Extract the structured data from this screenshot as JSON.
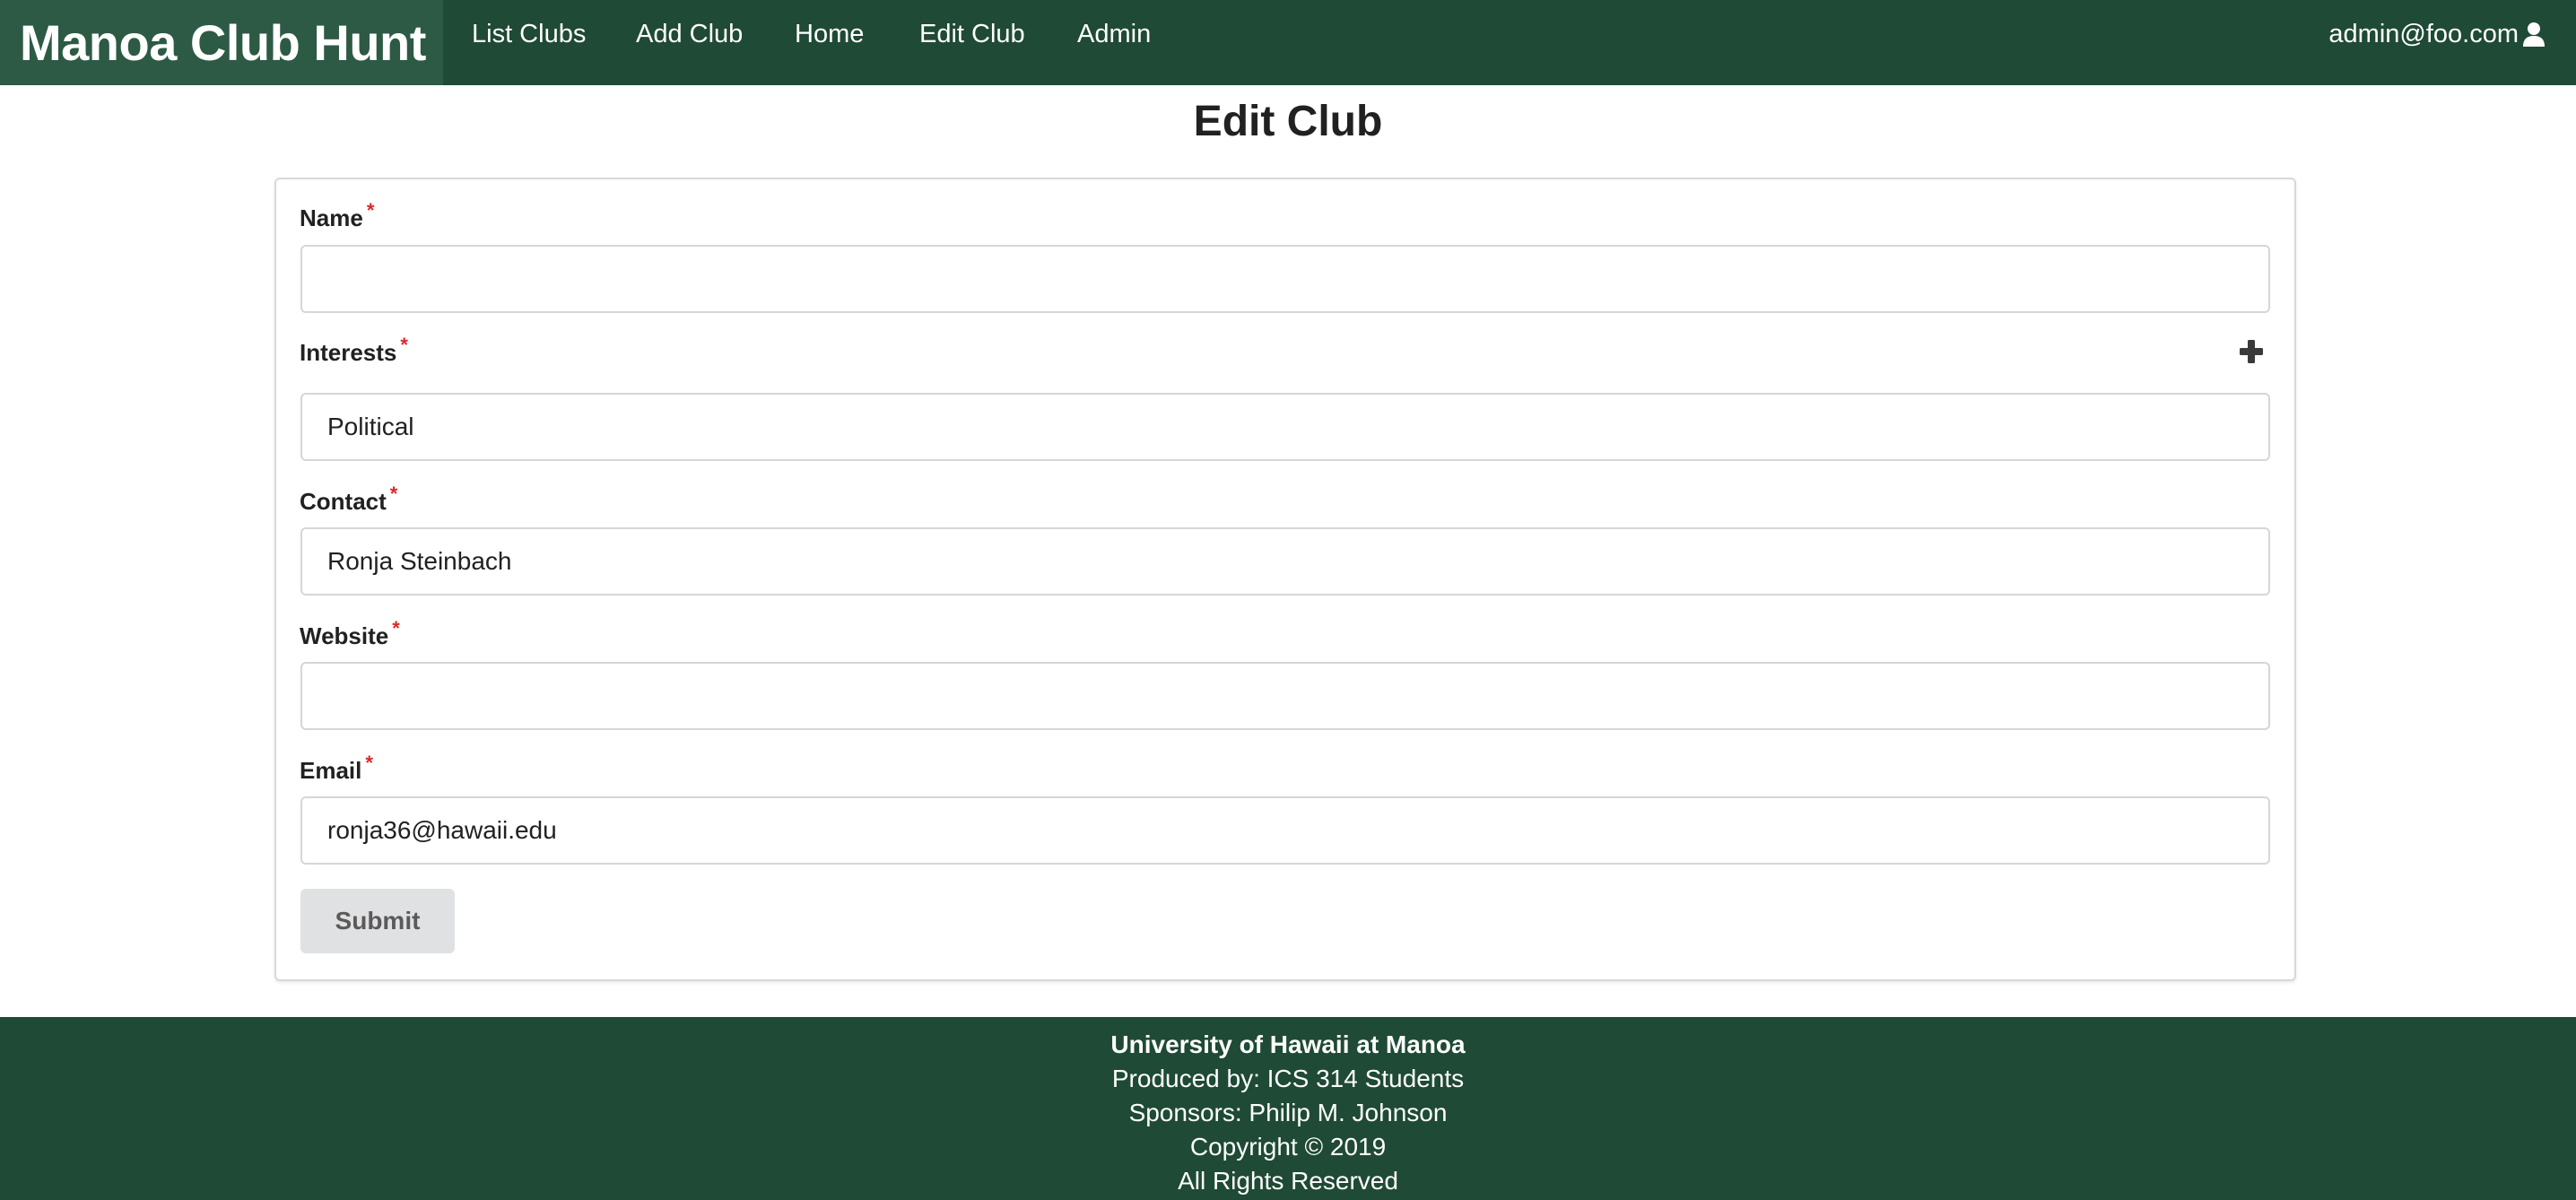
{
  "navbar": {
    "brand": "Manoa Club Hunt",
    "items": [
      "List Clubs",
      "Add Club",
      "Home",
      "Edit Club",
      "Admin"
    ],
    "user": "admin@foo.com",
    "user_icon": "user-icon"
  },
  "page": {
    "title": "Edit Club"
  },
  "form": {
    "required_marker": "*",
    "name": {
      "label": "Name",
      "value": ""
    },
    "interests": {
      "label": "Interests",
      "value": "Political",
      "add_icon": "plus-icon"
    },
    "contact": {
      "label": "Contact",
      "value": "Ronja Steinbach"
    },
    "website": {
      "label": "Website",
      "value": ""
    },
    "email": {
      "label": "Email",
      "value": "ronja36@hawaii.edu"
    },
    "submit_label": "Submit"
  },
  "footer": {
    "lines": [
      "University of Hawaii at Manoa",
      "Produced by: ICS 314 Students",
      "Sponsors: Philip M. Johnson",
      "Copyright © 2019",
      "All Rights Reserved"
    ]
  }
}
